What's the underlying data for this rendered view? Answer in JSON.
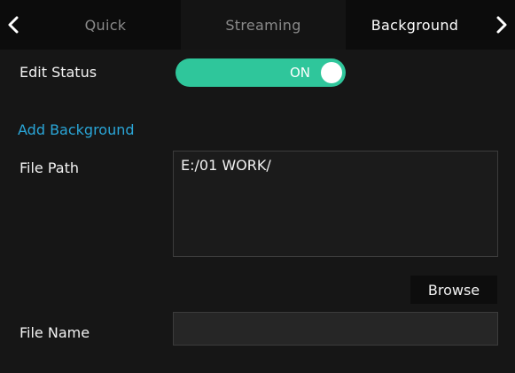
{
  "tabs": {
    "prev_icon": "chevron-left-icon",
    "next_icon": "chevron-right-icon",
    "items": [
      {
        "label": "Quick",
        "active": false
      },
      {
        "label": "Streaming",
        "active": false
      },
      {
        "label": "Background",
        "active": true
      }
    ]
  },
  "edit_status": {
    "label": "Edit Status",
    "toggle_text": "ON",
    "on": true,
    "color": "#2fc69b"
  },
  "add_background": {
    "title": "Add Background",
    "title_color": "#2aa6d8",
    "file_path_label": "File Path",
    "file_path_value": "E:/01 WORK/",
    "browse_label": "Browse",
    "file_name_label": "File Name",
    "file_name_value": ""
  }
}
